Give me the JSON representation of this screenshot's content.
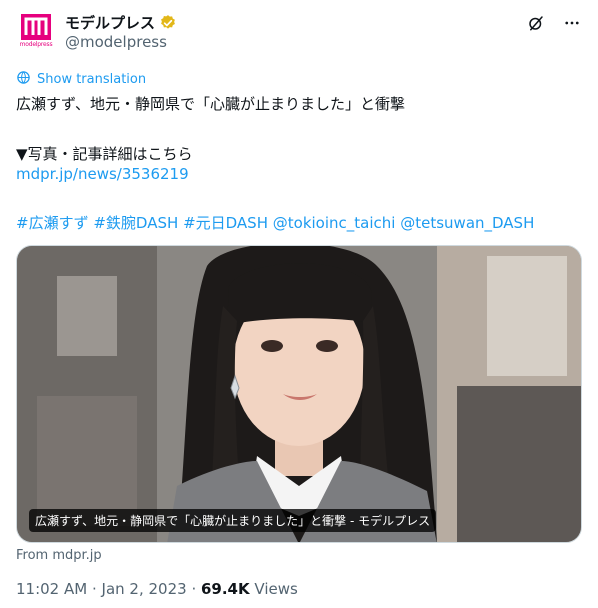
{
  "account": {
    "display_name": "モデルプレス",
    "handle": "@modelpress",
    "logo_text": "modelpress",
    "verified_color": "#e2b719",
    "logo_color": "#e6007e"
  },
  "actions": {
    "grok_icon": "grok-icon",
    "more_icon": "more-icon"
  },
  "translation": {
    "label": "Show translation",
    "icon": "globe-icon"
  },
  "tweet": {
    "line1": "広瀬すず、地元・静岡県で「心臓が止まりました」と衝撃",
    "line2": "▼写真・記事詳細はこちら",
    "link": "mdpr.jp/news/3536219",
    "hashtag1": "#広瀬すず",
    "hashtag2": "#鉄腕DASH",
    "hashtag3": "#元日DASH",
    "mention1": "@tokioinc_taichi",
    "mention2": "@tetsuwan_DASH"
  },
  "card": {
    "caption": "広瀬すず、地元・静岡県で「心臓が止まりました」と衝撃 - モデルプレス",
    "source": "From mdpr.jp"
  },
  "meta": {
    "time": "11:02 AM",
    "separator": " · ",
    "date": "Jan 2, 2023",
    "separator2": " · ",
    "views_count": "69.4K",
    "views_label": " Views"
  },
  "colors": {
    "link": "#1d9bf0",
    "secondary_text": "#536471"
  }
}
